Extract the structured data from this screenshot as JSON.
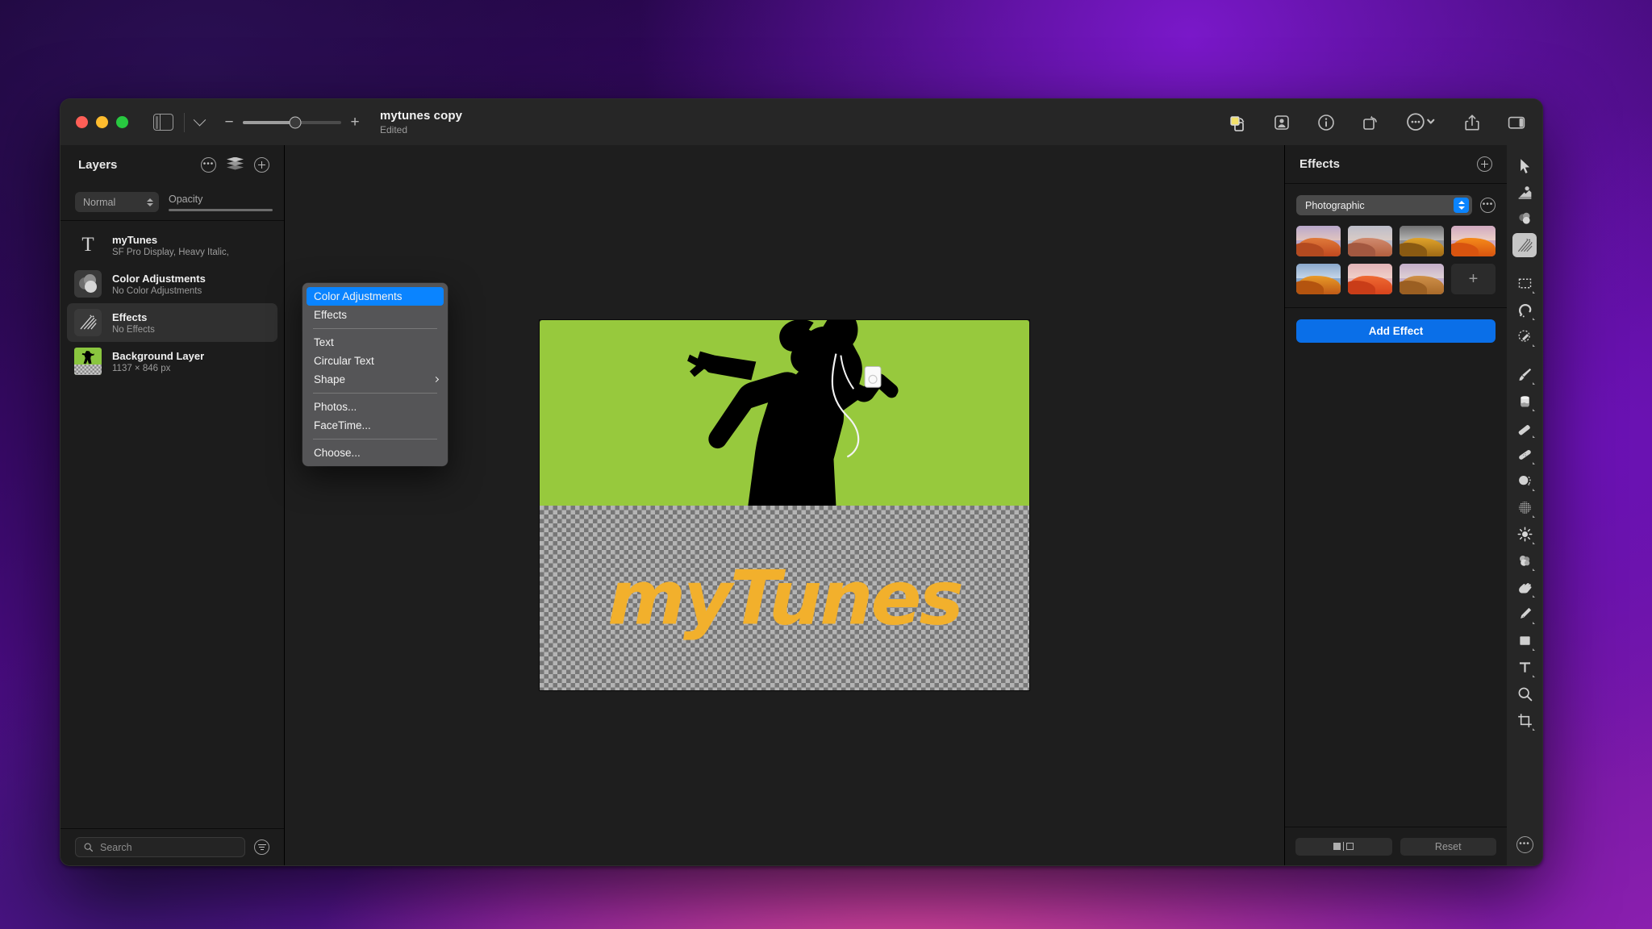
{
  "window": {
    "title": "mytunes copy",
    "subtitle": "Edited",
    "traffic_lights": [
      "close",
      "minimize",
      "zoom"
    ],
    "toolbar_icons": [
      "color-swap-icon",
      "portrait-icon",
      "info-icon",
      "rotate-icon",
      "more-icon",
      "share-icon",
      "inspector-toggle-icon"
    ]
  },
  "zoom_control": {
    "minus": "−",
    "plus": "+",
    "value_percent": 53
  },
  "left_panel": {
    "title": "Layers",
    "header_icons": [
      "more-options-icon",
      "layer-stack-icon",
      "add-layer-icon"
    ],
    "blend_mode": "Normal",
    "opacity_label": "Opacity",
    "layers": [
      {
        "name": "myTunes",
        "detail": "SF Pro Display, Heavy Italic,",
        "thumb": "text",
        "selected": false
      },
      {
        "name": "Color Adjustments",
        "detail": "No Color Adjustments",
        "thumb": "color",
        "selected": false
      },
      {
        "name": "Effects",
        "detail": "No Effects",
        "thumb": "effects",
        "selected": true
      },
      {
        "name": "Background Layer",
        "detail": "1137 × 846 px",
        "thumb": "background",
        "selected": false
      }
    ],
    "search_placeholder": "Search",
    "filter_icon": "filter-icon"
  },
  "context_menu": {
    "items": [
      {
        "label": "Color Adjustments",
        "highlighted": true
      },
      {
        "label": "Effects"
      },
      {
        "separator": true
      },
      {
        "label": "Text"
      },
      {
        "label": "Circular Text"
      },
      {
        "label": "Shape",
        "submenu": true
      },
      {
        "separator": true
      },
      {
        "label": "Photos..."
      },
      {
        "label": "FaceTime..."
      },
      {
        "separator": true
      },
      {
        "label": "Choose..."
      }
    ]
  },
  "canvas": {
    "wordmark": "myTunes",
    "top_band_color": "#97c93d",
    "wordmark_color": "#f2b02c",
    "silhouette_color": "#000000"
  },
  "right_panel": {
    "title": "Effects",
    "add_icon": "add-effect-group-icon",
    "preset": "Photographic",
    "preset_more_icon": "preset-options-icon",
    "thumbnails": [
      {
        "name": "effect-thumb-1",
        "sky": "#b9a8cb",
        "dune": "#d9622c"
      },
      {
        "name": "effect-thumb-2",
        "sky": "#bcbdc9",
        "dune": "#c06b50"
      },
      {
        "name": "effect-thumb-3",
        "sky": "#8f8f92",
        "dune": "#c98a28"
      },
      {
        "name": "effect-thumb-4",
        "sky": "#cfa9c0",
        "dune": "#e8731b"
      },
      {
        "name": "effect-thumb-5",
        "sky": "#8aa8cc",
        "dune": "#d1711f"
      },
      {
        "name": "effect-thumb-6",
        "sky": "#e2b3b6",
        "dune": "#e4552a"
      },
      {
        "name": "effect-thumb-7",
        "sky": "#c4aec9",
        "dune": "#c07b3c"
      }
    ],
    "add_tile": "+",
    "add_effect_button": "Add Effect",
    "compare_button": "compare",
    "reset_button": "Reset",
    "footer_more_icon": "panel-options-icon"
  },
  "tool_rail": {
    "tools": [
      {
        "name": "select-arrow-tool",
        "selected": false
      },
      {
        "name": "shape-fill-tool",
        "selected": false
      },
      {
        "name": "color-adjustments-tool",
        "selected": false
      },
      {
        "name": "effects-tool",
        "selected": true
      },
      {
        "name": "rectangular-marquee-tool",
        "selected": false
      },
      {
        "name": "magnetic-lasso-tool",
        "selected": false
      },
      {
        "name": "smart-selection-tool",
        "selected": false
      },
      {
        "name": "paintbrush-tool",
        "selected": false
      },
      {
        "name": "paint-bucket-tool",
        "selected": false
      },
      {
        "name": "eraser-tool",
        "selected": false
      },
      {
        "name": "repair-tool",
        "selected": false
      },
      {
        "name": "clone-stamp-tool",
        "selected": false
      },
      {
        "name": "halftone-tool",
        "selected": false
      },
      {
        "name": "brightness-tool",
        "selected": false
      },
      {
        "name": "blur-tool",
        "selected": false
      },
      {
        "name": "smudge-tool",
        "selected": false
      },
      {
        "name": "pen-tool",
        "selected": false
      },
      {
        "name": "shape-rectangle-tool",
        "selected": false
      },
      {
        "name": "text-tool",
        "selected": false
      },
      {
        "name": "zoom-tool",
        "selected": false
      },
      {
        "name": "crop-tool",
        "selected": false
      }
    ],
    "footer_icon": "rail-options-icon"
  }
}
